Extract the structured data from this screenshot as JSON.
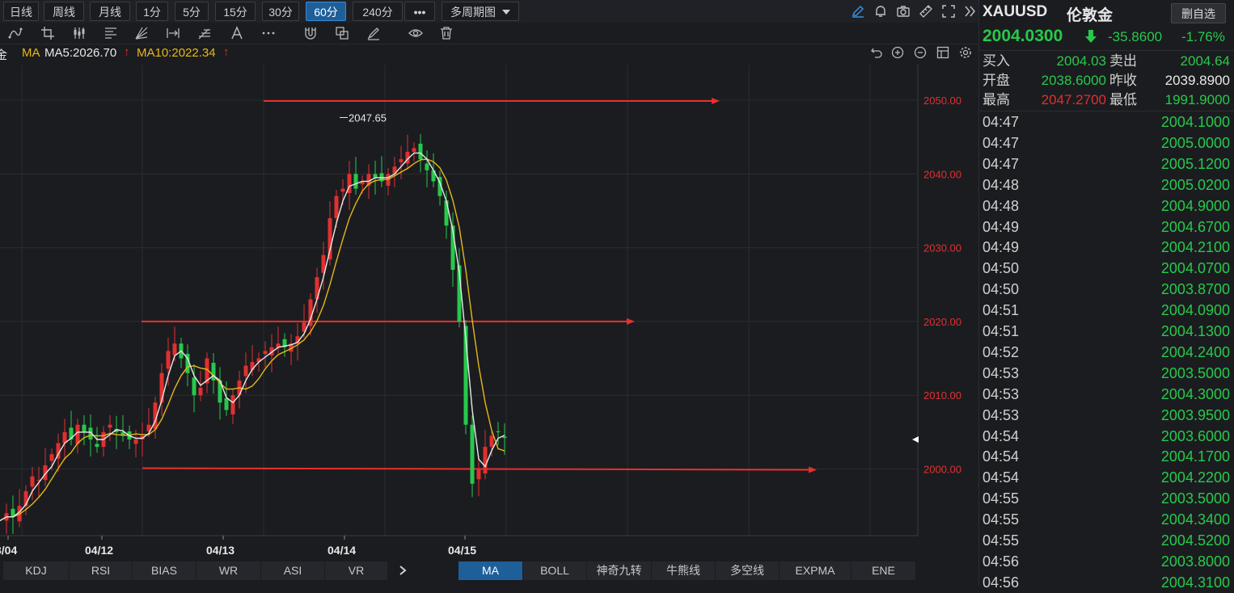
{
  "periods": [
    "日线",
    "周线",
    "月线",
    "1分",
    "5分",
    "15分",
    "30分",
    "60分",
    "240分"
  ],
  "active_period": "60分",
  "more_label": "•••",
  "multi_period_label": "多周期图",
  "legend": {
    "prefix": "金",
    "ma_label": "MA",
    "ma5": "MA5:2026.70",
    "ma10": "MA10:2022.34",
    "ma5_color": "#e8e8e8",
    "ma10_color": "#e6b818"
  },
  "bottom_tabs": [
    "KDJ",
    "RSI",
    "BIAS",
    "WR",
    "ASI",
    "VR",
    "MA",
    "BOLL",
    "神奇九转",
    "牛熊线",
    "多空线",
    "EXPMA",
    "ENE"
  ],
  "active_bottom_tab": "MA",
  "quote": {
    "symbol": "XAUUSD",
    "name": "伦敦金",
    "delete_label": "删自选",
    "last": "2004.0300",
    "change": "-35.8600",
    "change_pct": "-1.76%",
    "buy_label": "买入",
    "buy": "2004.03",
    "sell_label": "卖出",
    "sell": "2004.64",
    "open_label": "开盘",
    "open": "2038.6000",
    "prevclose_label": "昨收",
    "prevclose": "2039.8900",
    "high_label": "最高",
    "high": "2047.2700",
    "low_label": "最低",
    "low": "1991.9000"
  },
  "ticks": [
    {
      "time": "04:47",
      "price": "2004.1000"
    },
    {
      "time": "04:47",
      "price": "2005.0000"
    },
    {
      "time": "04:47",
      "price": "2005.1200"
    },
    {
      "time": "04:48",
      "price": "2005.0200"
    },
    {
      "time": "04:48",
      "price": "2004.9000"
    },
    {
      "time": "04:49",
      "price": "2004.6700"
    },
    {
      "time": "04:49",
      "price": "2004.2100"
    },
    {
      "time": "04:50",
      "price": "2004.0700"
    },
    {
      "time": "04:50",
      "price": "2003.8700"
    },
    {
      "time": "04:51",
      "price": "2004.0900"
    },
    {
      "time": "04:51",
      "price": "2004.1300"
    },
    {
      "time": "04:52",
      "price": "2004.2400"
    },
    {
      "time": "04:53",
      "price": "2003.5000"
    },
    {
      "time": "04:53",
      "price": "2004.3000"
    },
    {
      "time": "04:53",
      "price": "2003.9500"
    },
    {
      "time": "04:54",
      "price": "2003.6000"
    },
    {
      "time": "04:54",
      "price": "2004.1700"
    },
    {
      "time": "04:54",
      "price": "2004.2200"
    },
    {
      "time": "04:55",
      "price": "2003.5000"
    },
    {
      "time": "04:55",
      "price": "2004.3400"
    },
    {
      "time": "04:55",
      "price": "2004.5200"
    },
    {
      "time": "04:56",
      "price": "2003.8000"
    },
    {
      "time": "04:56",
      "price": "2004.3100"
    }
  ],
  "chart_data": {
    "type": "candlestick",
    "y_axis_labels": [
      "2050.00",
      "2040.00",
      "2030.00",
      "2020.00",
      "2010.00",
      "2000.00"
    ],
    "y_axis_values": [
      2050,
      2040,
      2030,
      2020,
      2010,
      2000
    ],
    "ylim": [
      1991,
      2057
    ],
    "x_labels": [
      "3/04",
      "04/12",
      "04/13",
      "04/14",
      "04/15"
    ],
    "max_annotation": {
      "label": "2047.65",
      "value": 2047.65
    },
    "horizontal_lines": [
      2050,
      2020,
      2000
    ],
    "up_color": "#e03030",
    "down_color": "#27c94b",
    "grid": true,
    "series": [
      {
        "name": "MA5:2026.70"
      },
      {
        "name": "MA10:2022.34"
      }
    ]
  }
}
